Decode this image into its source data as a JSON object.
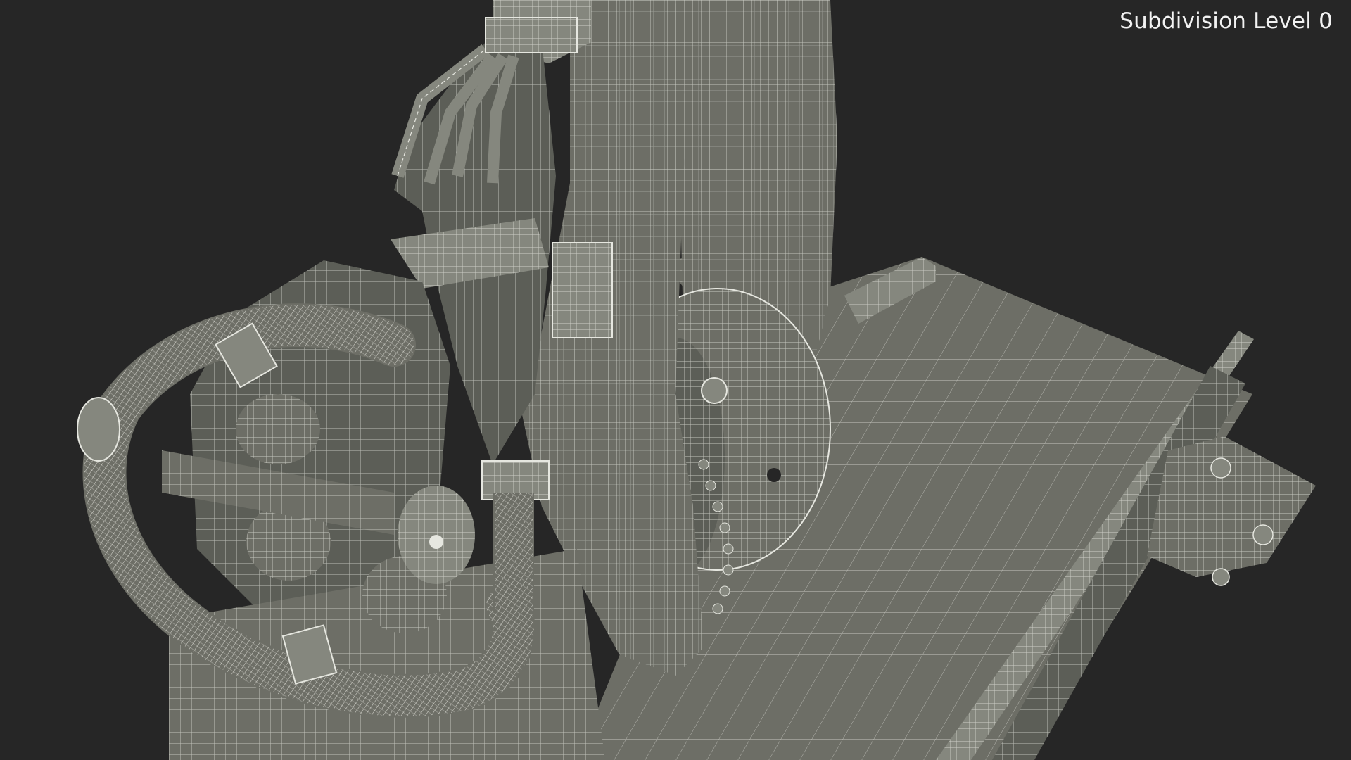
{
  "viewport": {
    "overlay_label": "Subdivision Level 0"
  },
  "colors": {
    "background": "#262626",
    "surface": "#6d6e66",
    "surface_light": "#85877e",
    "surface_dark": "#50524c",
    "wire": "#e6e7e0"
  }
}
